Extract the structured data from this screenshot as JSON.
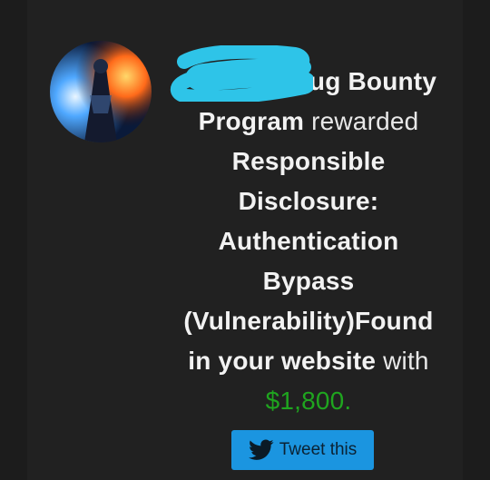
{
  "message": {
    "line1_bold": "ug Bounty",
    "line2_bold": "Program",
    "line2_normal": " rewarded",
    "line3_bold": "Responsible",
    "line4_bold": "Disclosure:",
    "line5_bold": "Authentication",
    "line6_bold": "Bypass",
    "line7_bold": "(Vulnerability)Found",
    "line8_bold": "in your website",
    "line8_normal": " with",
    "amount": "$1,800.",
    "amount_color": "#1fa51f"
  },
  "tweet_button": {
    "label": "Tweet this",
    "icon": "twitter-bird-icon",
    "color": "#1b95e0"
  },
  "redaction_color": "#2ec4e8"
}
